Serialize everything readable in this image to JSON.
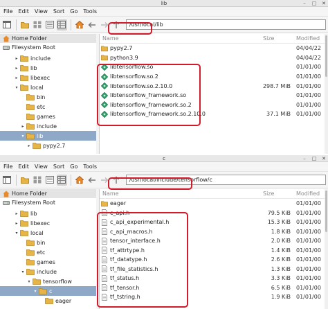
{
  "window1": {
    "title": "lib",
    "menu": [
      "File",
      "Edit",
      "View",
      "Sort",
      "Go",
      "Tools"
    ],
    "path": "/usr/local/lib",
    "places": [
      "Home Folder",
      "Filesystem Root"
    ],
    "tree": [
      {
        "label": "include",
        "depth": 2,
        "expander": "▸",
        "selected": false
      },
      {
        "label": "lib",
        "depth": 2,
        "expander": "▸",
        "selected": false
      },
      {
        "label": "libexec",
        "depth": 2,
        "expander": "▸",
        "selected": false
      },
      {
        "label": "local",
        "depth": 2,
        "expander": "▾",
        "selected": false
      },
      {
        "label": "bin",
        "depth": 3,
        "expander": "",
        "selected": false
      },
      {
        "label": "etc",
        "depth": 3,
        "expander": "",
        "selected": false
      },
      {
        "label": "games",
        "depth": 3,
        "expander": "",
        "selected": false
      },
      {
        "label": "include",
        "depth": 3,
        "expander": "▸",
        "selected": false
      },
      {
        "label": "lib",
        "depth": 3,
        "expander": "▾",
        "selected": true
      },
      {
        "label": "pypy2.7",
        "depth": 4,
        "expander": "▸",
        "selected": false
      }
    ],
    "columns": {
      "name": "Name",
      "size": "Size",
      "modified": "Modified"
    },
    "files": [
      {
        "name": "pypy2.7",
        "type": "folder",
        "size": "",
        "modified": "04/04/22"
      },
      {
        "name": "python3.9",
        "type": "folder",
        "size": "",
        "modified": "04/04/22"
      },
      {
        "name": "libtensorflow.so",
        "type": "lib",
        "size": "",
        "modified": "01/01/00"
      },
      {
        "name": "libtensorflow.so.2",
        "type": "lib",
        "size": "",
        "modified": "01/01/00"
      },
      {
        "name": "libtensorflow.so.2.10.0",
        "type": "lib",
        "size": "298.7 MiB",
        "modified": "01/01/00"
      },
      {
        "name": "libtensorflow_framework.so",
        "type": "lib",
        "size": "",
        "modified": "01/01/00"
      },
      {
        "name": "libtensorflow_framework.so.2",
        "type": "lib",
        "size": "",
        "modified": "01/01/00"
      },
      {
        "name": "libtensorflow_framework.so.2.10.0",
        "type": "lib",
        "size": "37.1 MiB",
        "modified": "01/01/00"
      }
    ]
  },
  "window2": {
    "title": "c",
    "menu": [
      "File",
      "Edit",
      "View",
      "Sort",
      "Go",
      "Tools"
    ],
    "path": "/usr/local/include/tensorflow/c",
    "places": [
      "Home Folder",
      "Filesystem Root"
    ],
    "tree": [
      {
        "label": "lib",
        "depth": 2,
        "expander": "▸",
        "selected": false
      },
      {
        "label": "libexec",
        "depth": 2,
        "expander": "▸",
        "selected": false
      },
      {
        "label": "local",
        "depth": 2,
        "expander": "▾",
        "selected": false
      },
      {
        "label": "bin",
        "depth": 3,
        "expander": "",
        "selected": false
      },
      {
        "label": "etc",
        "depth": 3,
        "expander": "",
        "selected": false
      },
      {
        "label": "games",
        "depth": 3,
        "expander": "",
        "selected": false
      },
      {
        "label": "include",
        "depth": 3,
        "expander": "▾",
        "selected": false
      },
      {
        "label": "tensorflow",
        "depth": 4,
        "expander": "▾",
        "selected": false
      },
      {
        "label": "c",
        "depth": 5,
        "expander": "▾",
        "selected": true
      },
      {
        "label": "eager",
        "depth": 6,
        "expander": "",
        "selected": false
      }
    ],
    "columns": {
      "name": "Name",
      "size": "Size",
      "modified": "Modified"
    },
    "files": [
      {
        "name": "eager",
        "type": "folder",
        "size": "",
        "modified": "01/01/00"
      },
      {
        "name": "c_api.h",
        "type": "doc",
        "size": "79.5 KiB",
        "modified": "01/01/00"
      },
      {
        "name": "c_api_experimental.h",
        "type": "doc",
        "size": "15.3 KiB",
        "modified": "01/01/00"
      },
      {
        "name": "c_api_macros.h",
        "type": "doc",
        "size": "1.8 KiB",
        "modified": "01/01/00"
      },
      {
        "name": "tensor_interface.h",
        "type": "doc",
        "size": "2.0 KiB",
        "modified": "01/01/00"
      },
      {
        "name": "tf_attrtype.h",
        "type": "doc",
        "size": "1.4 KiB",
        "modified": "01/01/00"
      },
      {
        "name": "tf_datatype.h",
        "type": "doc",
        "size": "2.6 KiB",
        "modified": "01/01/00"
      },
      {
        "name": "tf_file_statistics.h",
        "type": "doc",
        "size": "1.3 KiB",
        "modified": "01/01/00"
      },
      {
        "name": "tf_status.h",
        "type": "doc",
        "size": "3.3 KiB",
        "modified": "01/01/00"
      },
      {
        "name": "tf_tensor.h",
        "type": "doc",
        "size": "6.5 KiB",
        "modified": "01/01/00"
      },
      {
        "name": "tf_tstring.h",
        "type": "doc",
        "size": "1.9 KiB",
        "modified": "01/01/00"
      }
    ]
  },
  "colors": {
    "highlight": "#d11a2a",
    "folder": "#e6b545",
    "selection": "#8ea8c8",
    "lib_icon": "#2f9e6a"
  }
}
